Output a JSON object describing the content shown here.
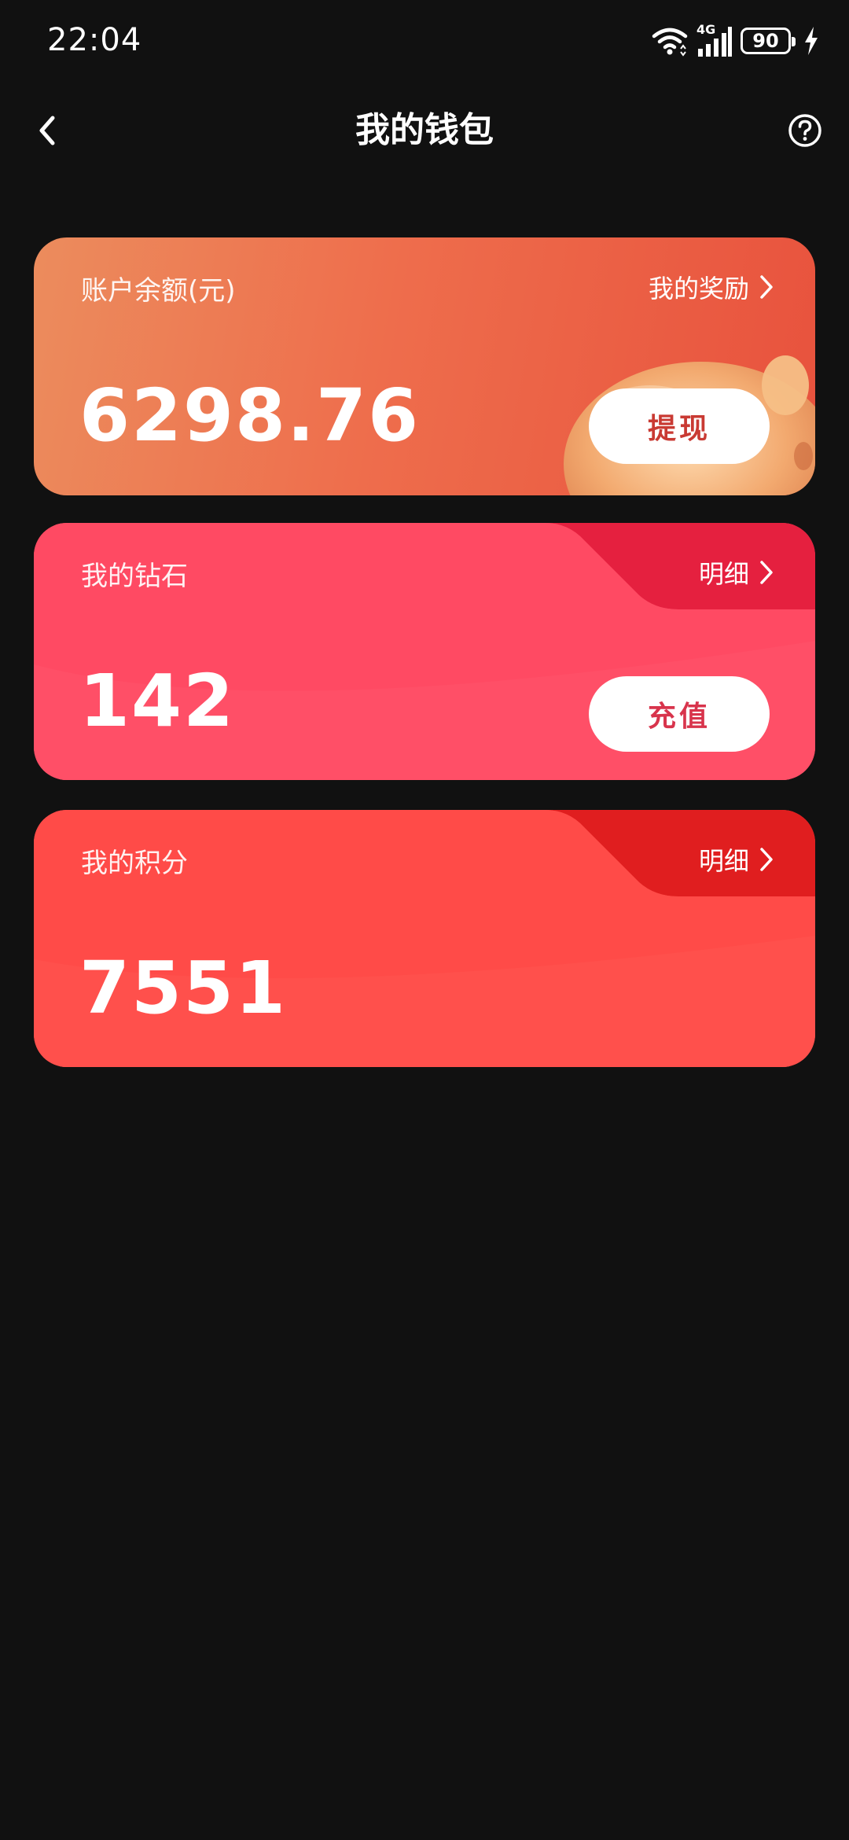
{
  "status_bar": {
    "time": "22:04",
    "network_label": "4G",
    "battery_level": "90"
  },
  "nav": {
    "title": "我的钱包"
  },
  "balance_card": {
    "label": "账户余额(元)",
    "amount": "6298.76",
    "link_label": "我的奖励",
    "button_label": "提现"
  },
  "diamond_card": {
    "label": "我的钻石",
    "amount": "142",
    "link_label": "明细",
    "button_label": "充值"
  },
  "points_card": {
    "label": "我的积分",
    "amount": "7551",
    "link_label": "明细"
  },
  "colors": {
    "background": "#111111",
    "balance_card": "#ee6d4c",
    "diamond_card": "#ff4a63",
    "points_card": "#ff4b48",
    "button_text": "#c93a33"
  },
  "icons": {
    "back": "chevron-left-icon",
    "help": "question-circle-icon",
    "link_arrow": "chevron-right-icon",
    "wifi": "wifi-icon",
    "signal": "signal-icon",
    "battery": "battery-icon",
    "charging": "lightning-icon",
    "decoration": "piggy-bank-icon"
  }
}
